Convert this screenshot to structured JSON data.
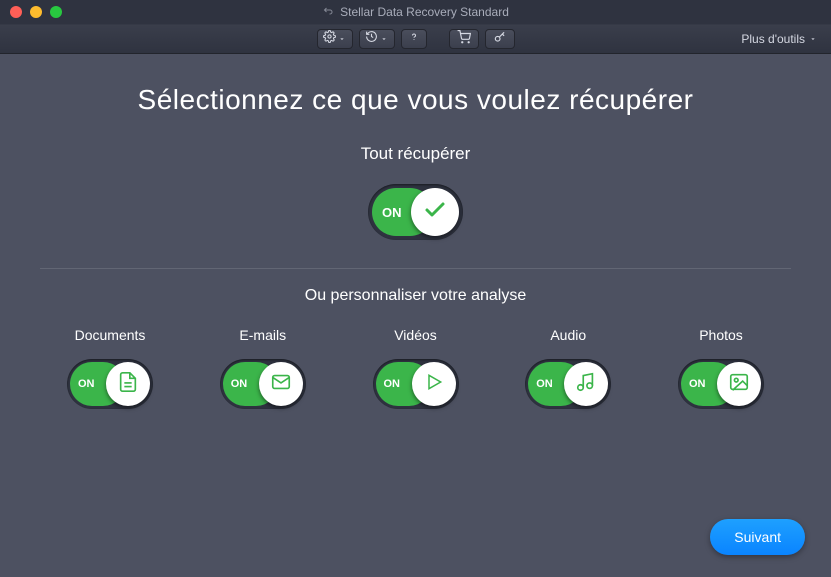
{
  "window": {
    "title": "Stellar Data Recovery Standard"
  },
  "toolbar": {
    "more_tools": "Plus d'outils"
  },
  "main": {
    "headline": "Sélectionnez ce que vous voulez récupérer",
    "recover_all_label": "Tout récupérer",
    "customize_label": "Ou personnaliser votre analyse",
    "toggle_on_text": "ON",
    "categories": [
      {
        "label": "Documents",
        "icon": "document-icon",
        "on": true
      },
      {
        "label": "E-mails",
        "icon": "mail-icon",
        "on": true
      },
      {
        "label": "Vidéos",
        "icon": "video-icon",
        "on": true
      },
      {
        "label": "Audio",
        "icon": "audio-icon",
        "on": true
      },
      {
        "label": "Photos",
        "icon": "photo-icon",
        "on": true
      }
    ]
  },
  "footer": {
    "next": "Suivant"
  },
  "colors": {
    "accent_green": "#3bb54a",
    "accent_blue": "#0a84ff",
    "bg": "#4d5161"
  }
}
